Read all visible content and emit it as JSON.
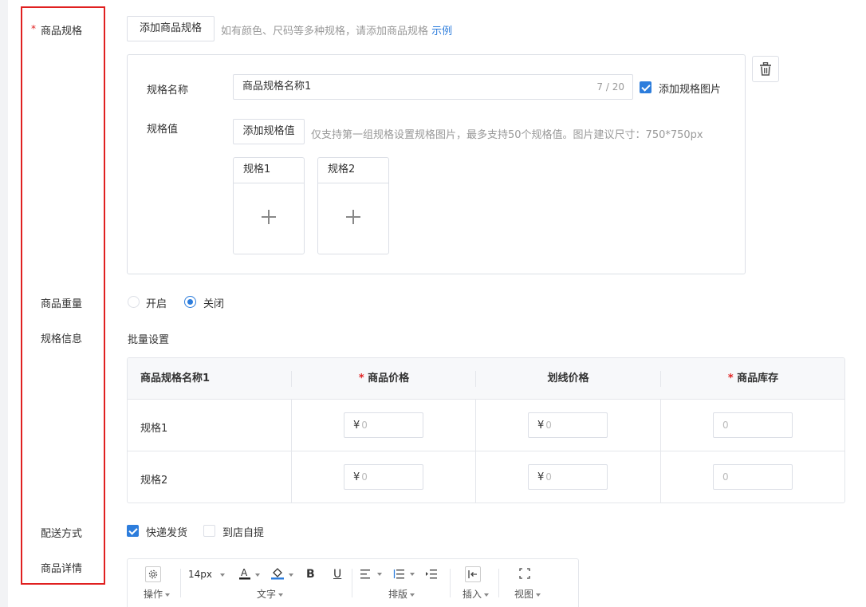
{
  "fields": {
    "spec_label": "商品规格",
    "weight_label": "商品重量",
    "spec_info_label": "规格信息",
    "delivery_label": "配送方式",
    "detail_label": "商品详情",
    "required_mark": "*"
  },
  "spec": {
    "add_button": "添加商品规格",
    "hint": "如有颜色、尺码等多种规格，请添加商品规格",
    "example_link": "示例",
    "name_label": "规格名称",
    "name_value": "商品规格名称1",
    "name_counter": "7 / 20",
    "add_image_label": "添加规格图片",
    "add_image_checked": true,
    "value_label": "规格值",
    "add_value_button": "添加规格值",
    "value_hint": "仅支持第一组规格设置规格图片，最多支持50个规格值。图片建议尺寸：750*750px",
    "cards": [
      {
        "label": "规格1"
      },
      {
        "label": "规格2"
      }
    ]
  },
  "weight": {
    "options": [
      {
        "label": "开启",
        "selected": false
      },
      {
        "label": "关闭",
        "selected": true
      }
    ]
  },
  "spec_info": {
    "batch_link": "批量设置",
    "columns": [
      "商品规格名称1",
      "商品价格",
      "划线价格",
      "商品库存"
    ],
    "required_columns": [
      false,
      true,
      false,
      true
    ],
    "rows": [
      {
        "name": "规格1",
        "price": "0",
        "strike_price": "0",
        "stock": "0"
      },
      {
        "name": "规格2",
        "price": "0",
        "strike_price": "0",
        "stock": "0"
      }
    ],
    "currency": "¥"
  },
  "delivery": {
    "options": [
      {
        "label": "快递发货",
        "checked": true
      },
      {
        "label": "到店自提",
        "checked": false
      }
    ]
  },
  "editor": {
    "font_size": "14px",
    "groups": [
      "操作",
      "文字",
      "排版",
      "插入",
      "视图"
    ]
  },
  "colors": {
    "accent": "#2d7ddc",
    "required": "#e02020",
    "highlight_border": "#e02020"
  }
}
